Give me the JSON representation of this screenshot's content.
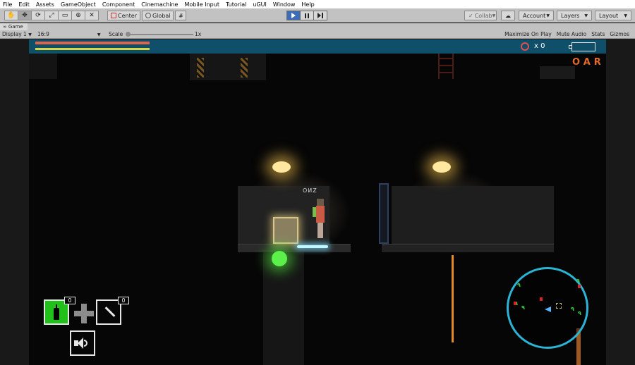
{
  "menu": [
    "File",
    "Edit",
    "Assets",
    "GameObject",
    "Component",
    "Cinemachine",
    "Mobile Input",
    "Tutorial",
    "uGUI",
    "Window",
    "Help"
  ],
  "toolbar": {
    "pivot_label": "Center",
    "space_label": "Global",
    "collab_label": "Collab",
    "account_label": "Account",
    "layers_label": "Layers",
    "layout_label": "Layout"
  },
  "game_tab": {
    "label": "Game"
  },
  "game_bar": {
    "display": "Display 1",
    "aspect": "16:9",
    "scale_label": "Scale",
    "scale_value": "1x",
    "maximize_on_play": "Maximize On Play",
    "mute_audio": "Mute Audio",
    "stats": "Stats",
    "gizmos": "Gizmos"
  },
  "hud": {
    "ring_count": "x 0",
    "corner_text": "OAR",
    "character_label": "ОИZ",
    "bottle_count": "0",
    "knife_count": "0"
  },
  "colors": {
    "hud_bar": "#0f4f6a",
    "health": "#e0644c",
    "stamina": "#d9d645",
    "ring": "#e05050",
    "minimap_ring": "#2cb4d6",
    "play_active": "#3d6cb8"
  }
}
